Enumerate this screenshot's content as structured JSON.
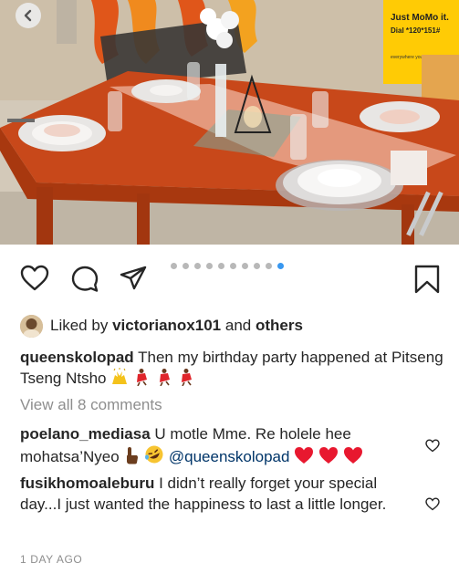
{
  "photo": {
    "poster_title": "Just MoMo it.",
    "poster_subtitle": "Dial *120*151#",
    "poster_footer": "everywhere you go"
  },
  "carousel": {
    "count": 10,
    "active_index": 9
  },
  "likes": {
    "prefix": "Liked by",
    "user": "victorianox101",
    "joiner": "and",
    "others": "others"
  },
  "caption": {
    "username": "queenskolopad",
    "text": "Then my birthday party happened at Pitseng Tseng Ntsho",
    "emojis": [
      "raising-hands",
      "dancer",
      "dancer",
      "dancer"
    ]
  },
  "view_all_comments": "View all 8 comments",
  "comments": [
    {
      "username": "poelano_mediasa",
      "text_before": "U motle Mme. Re holele hee mohatsa’Nyeo",
      "emojis_mid": [
        "pointing-up-dark",
        "rofl"
      ],
      "mention": "@queenskolopad",
      "emojis_end": [
        "red-heart",
        "red-heart",
        "red-heart"
      ]
    },
    {
      "username": "fusikhomoaleburu",
      "text": "I didn’t really forget your special day...I just wanted the happiness to last a little longer."
    }
  ],
  "timestamp": "1 DAY AGO",
  "colors": {
    "accent_blue": "#3897f0",
    "heart_red": "#ed1c3a",
    "muted": "#8e8e8e"
  }
}
